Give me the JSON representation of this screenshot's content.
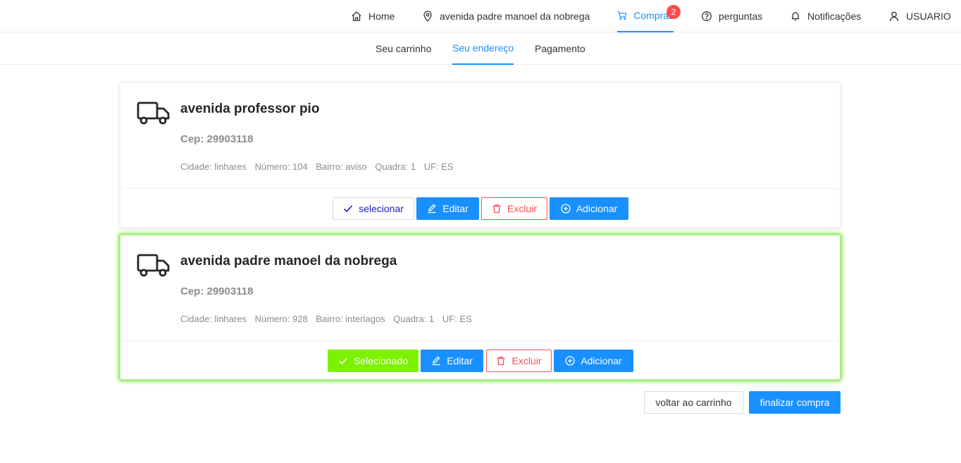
{
  "nav": {
    "home": "Home",
    "address": "avenida padre manoel da nobrega",
    "compras": "Compras",
    "compras_badge": "2",
    "perguntas": "perguntas",
    "notificacoes": "Notificações",
    "usuario": "USUARIO"
  },
  "subnav": {
    "carrinho": "Seu carrinho",
    "endereco": "Seu endereço",
    "pagamento": "Pagamento"
  },
  "addresses": [
    {
      "title": "avenida professor pio",
      "cep": "Cep: 29903118",
      "cidade": "Cidade: linhares",
      "numero": "Número: 104",
      "bairro": "Bairro: aviso",
      "quadra": "Quadra: 1",
      "uf": "UF: ES",
      "select_label": "selecionar",
      "edit_label": "Editar",
      "delete_label": "Excluir",
      "add_label": "Adicionar"
    },
    {
      "title": "avenida padre manoel da nobrega",
      "cep": "Cep: 29903118",
      "cidade": "Cidade: linhares",
      "numero": "Número: 928",
      "bairro": "Bairro: interlagos",
      "quadra": "Quadra: 1",
      "uf": "UF: ES",
      "select_label": "Selecionado",
      "edit_label": "Editar",
      "delete_label": "Excluir",
      "add_label": "Adicionar"
    }
  ],
  "footer": {
    "back_label": "voltar ao carrinho",
    "finish_label": "finalizar compra"
  },
  "colors": {
    "primary": "#1890ff",
    "danger": "#ff4d4f",
    "selected": "#7cf200",
    "badge": "#ff4d4f"
  }
}
